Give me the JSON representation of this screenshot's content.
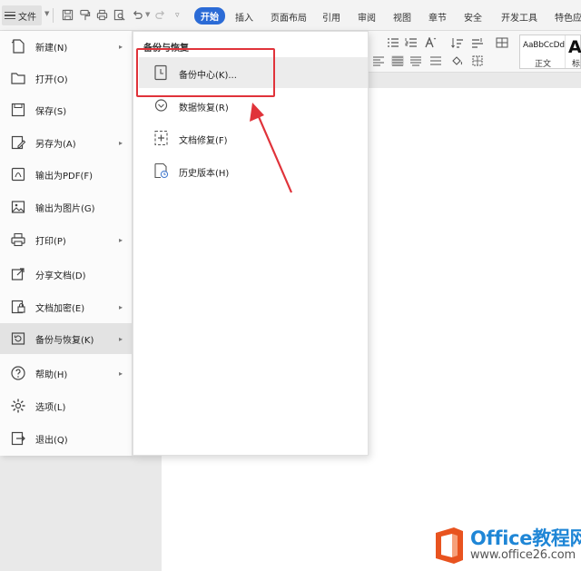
{
  "toolbar": {
    "file_label": "文件",
    "tabs": [
      {
        "label": "开始",
        "active": true
      },
      {
        "label": "插入"
      },
      {
        "label": "页面布局"
      },
      {
        "label": "引用"
      },
      {
        "label": "审阅"
      },
      {
        "label": "视图"
      },
      {
        "label": "章节"
      },
      {
        "label": "安全"
      },
      {
        "label": "开发工具"
      },
      {
        "label": "特色应"
      }
    ],
    "quick_access_icons": [
      "save-icon",
      "format-painter-icon",
      "print-icon",
      "print-preview-icon",
      "undo-icon",
      "redo-icon",
      "customize-icon"
    ]
  },
  "ribbon": {
    "style_gallery": {
      "sample_1": "AaBbCcDd",
      "name_1": "正文",
      "sample_2": "Aa",
      "name_2": "标"
    }
  },
  "file_menu": {
    "items": [
      {
        "label": "新建(N)",
        "icon": "new-document-icon",
        "has_submenu": true
      },
      {
        "label": "打开(O)",
        "icon": "folder-open-icon",
        "has_submenu": false
      },
      {
        "label": "保存(S)",
        "icon": "save-icon",
        "has_submenu": false
      },
      {
        "label": "另存为(A)",
        "icon": "save-as-icon",
        "has_submenu": true
      },
      {
        "label": "输出为PDF(F)",
        "icon": "pdf-export-icon",
        "has_submenu": false
      },
      {
        "label": "输出为图片(G)",
        "icon": "image-export-icon",
        "has_submenu": false
      },
      {
        "label": "打印(P)",
        "icon": "print-icon",
        "has_submenu": true
      },
      {
        "label": "分享文档(D)",
        "icon": "share-icon",
        "has_submenu": false
      },
      {
        "label": "文档加密(E)",
        "icon": "lock-icon",
        "has_submenu": true
      },
      {
        "label": "备份与恢复(K)",
        "icon": "backup-restore-icon",
        "has_submenu": true,
        "active": true
      },
      {
        "label": "帮助(H)",
        "icon": "help-icon",
        "has_submenu": true
      },
      {
        "label": "选项(L)",
        "icon": "gear-icon",
        "has_submenu": false
      },
      {
        "label": "退出(Q)",
        "icon": "exit-icon",
        "has_submenu": false
      }
    ]
  },
  "submenu": {
    "title": "备份与恢复",
    "items": [
      {
        "label": "备份中心(K)...",
        "icon": "backup-center-icon",
        "highlighted": true
      },
      {
        "label": "数据恢复(R)",
        "icon": "data-recovery-icon"
      },
      {
        "label": "文档修复(F)",
        "icon": "document-repair-icon"
      },
      {
        "label": "历史版本(H)",
        "icon": "history-version-icon"
      }
    ]
  },
  "watermark": {
    "title": "Office教程网",
    "url": "www.office26.com"
  },
  "colors": {
    "accent_tab": "#2b6bd6",
    "annotation_red": "#e0333a",
    "watermark_blue": "#1f86d6",
    "watermark_logo": "#e8531f"
  }
}
